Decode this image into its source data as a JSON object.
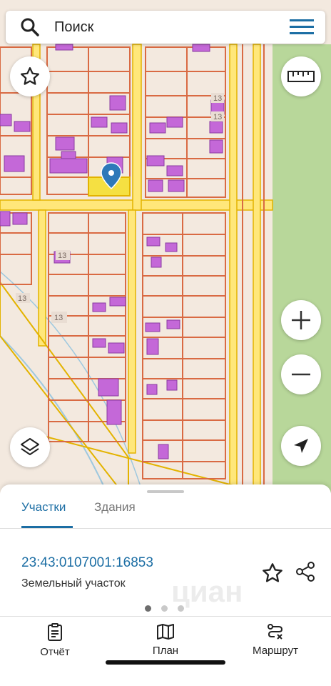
{
  "search": {
    "placeholder": "Поиск",
    "icon": "search-icon"
  },
  "menu": {
    "icon": "menu-icon"
  },
  "map": {
    "number_labels": [
      "13",
      "13",
      "13",
      "13",
      "13"
    ],
    "colors": {
      "background": "#f3e9df",
      "park": "#b8d79a",
      "road": "#ffe77a",
      "parcel_border": "#d96a43",
      "building": "#c468d8",
      "selected_parcel": "#f5e042",
      "pin": "#2e79b9"
    },
    "controls": {
      "favorite": "star-icon",
      "ruler": "ruler-icon",
      "zoom_in": "plus-icon",
      "zoom_out": "minus-icon",
      "layers": "layers-icon",
      "location": "navigation-arrow-icon"
    }
  },
  "sheet": {
    "tabs": [
      {
        "label": "Участки",
        "active": true
      },
      {
        "label": "Здания",
        "active": false
      }
    ],
    "parcel": {
      "number": "23:43:0107001:16853",
      "type": "Земельный участок",
      "watermark": "циан"
    },
    "pager": {
      "count": 3,
      "active_index": 0
    }
  },
  "bottom_nav": [
    {
      "label": "Отчёт",
      "icon": "report-icon"
    },
    {
      "label": "План",
      "icon": "map-icon"
    },
    {
      "label": "Маршрут",
      "icon": "route-icon"
    }
  ],
  "colors": {
    "accent": "#1c6ea4"
  }
}
